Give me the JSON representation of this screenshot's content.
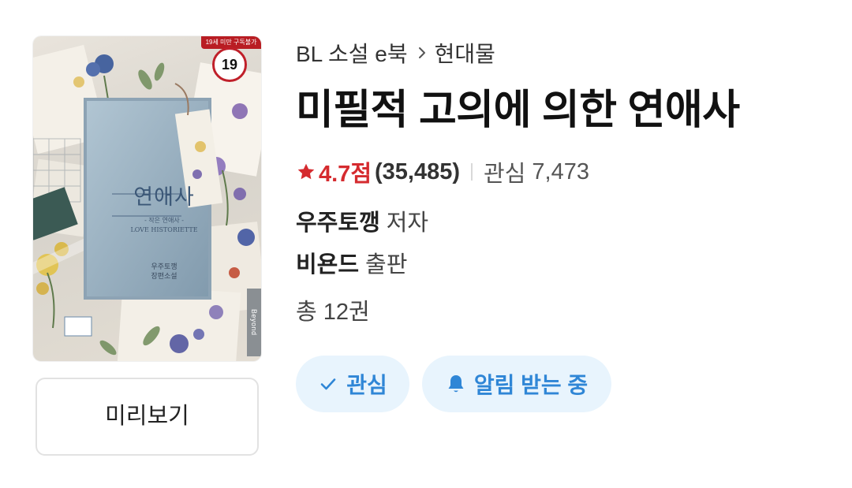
{
  "cover": {
    "age_banner": "19세 미만 구독불가",
    "age_badge": "19",
    "art_title": "연애사",
    "art_subtitle_1": "- 작은 연애사 -",
    "art_subtitle_2": "LOVE HISTORIETTE",
    "art_script": "Love Historiette",
    "art_author_1": "우주토깽",
    "art_author_2": "장편소설",
    "publisher_tab": "Beyond"
  },
  "preview_button": "미리보기",
  "breadcrumb": {
    "category": "BL 소설 e북",
    "subcategory": "현대물"
  },
  "title": "미필적 고의에 의한 연애사",
  "rating": {
    "score": "4.7점",
    "count": "(35,485)",
    "star_icon": "star-icon",
    "star_color": "#d52b2f"
  },
  "interest": {
    "label": "관심",
    "count": "7,473"
  },
  "author": {
    "name": "우주토깽",
    "role": "저자"
  },
  "publisher": {
    "name": "비욘드",
    "role": "출판"
  },
  "volumes": "총 12권",
  "actions": {
    "wish_label": "관심",
    "notify_label": "알림 받는 중",
    "accent_color": "#2f86d6",
    "pill_background": "#e8f4fd"
  }
}
